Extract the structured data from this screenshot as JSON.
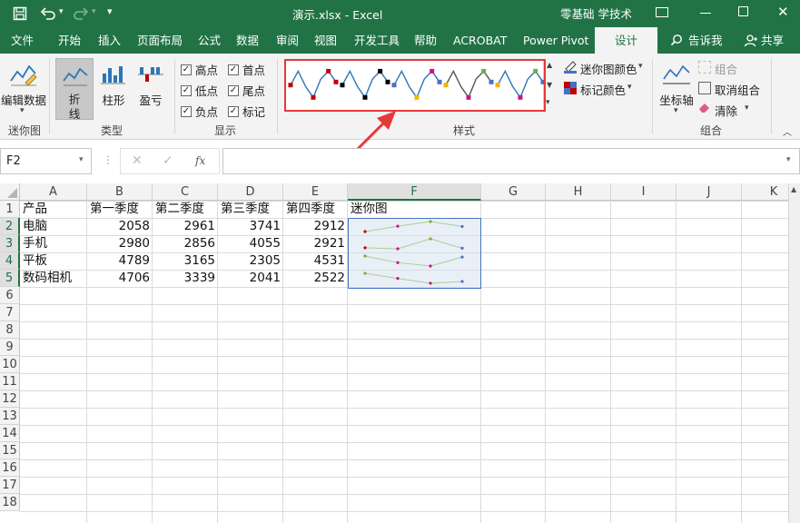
{
  "title_bar": {
    "document_title": "演示.xlsx  -  Excel",
    "account_label": "零基础 学技术",
    "qat_more": "▾"
  },
  "tabs": [
    "文件",
    "开始",
    "插入",
    "页面布局",
    "公式",
    "数据",
    "审阅",
    "视图",
    "开发工具",
    "帮助",
    "ACROBAT",
    "Power Pivot",
    "设计"
  ],
  "tell_me": "告诉我",
  "share": "共享",
  "ribbon": {
    "groups": {
      "sparkline": "迷你图",
      "type": "类型",
      "show": "显示",
      "style": "样式",
      "group": "组合"
    },
    "edit_data": "编辑数据",
    "types": [
      "折\n线",
      "柱形",
      "盈亏"
    ],
    "type_line_1": "折",
    "type_line_2": "线",
    "type_column": "柱形",
    "type_winloss": "盈亏",
    "show_options": [
      {
        "label": "高点",
        "checked": true
      },
      {
        "label": "首点",
        "checked": true
      },
      {
        "label": "低点",
        "checked": true
      },
      {
        "label": "尾点",
        "checked": true
      },
      {
        "label": "负点",
        "checked": true
      },
      {
        "label": "标记",
        "checked": true
      }
    ],
    "sparkline_color": "迷你图颜色",
    "marker_color": "标记颜色",
    "axis": "坐标轴",
    "group_btn": "组合",
    "ungroup": "取消组合",
    "clear": "清除",
    "style_colors": [
      "#c00000",
      "#000000",
      "#4472c4",
      "#70ad47"
    ]
  },
  "formula_bar": {
    "name_box": "F2",
    "fx": "fx",
    "formula": ""
  },
  "columns": [
    "A",
    "B",
    "C",
    "D",
    "E",
    "F",
    "G",
    "H",
    "I",
    "J",
    "K"
  ],
  "rows": [
    "1",
    "2",
    "3",
    "4",
    "5",
    "6",
    "7",
    "8",
    "9",
    "10",
    "11",
    "12",
    "13",
    "14",
    "15",
    "16",
    "17",
    "18"
  ],
  "sheet": {
    "headers": [
      "产品",
      "第一季度",
      "第二季度",
      "第三季度",
      "第四季度",
      "迷你图"
    ],
    "data": [
      {
        "product": "电脑",
        "q1": "2058",
        "q2": "2961",
        "q3": "3741",
        "q4": "2912",
        "values": [
          2058,
          2961,
          3741,
          2912
        ]
      },
      {
        "product": "手机",
        "q1": "2980",
        "q2": "2856",
        "q3": "4055",
        "q4": "2921",
        "values": [
          2980,
          2856,
          4055,
          2921
        ]
      },
      {
        "product": "平板",
        "q1": "4789",
        "q2": "3165",
        "q3": "2305",
        "q4": "4531",
        "values": [
          4789,
          3165,
          2305,
          4531
        ]
      },
      {
        "product": "数码相机",
        "q1": "4706",
        "q2": "3339",
        "q3": "2041",
        "q4": "2522",
        "values": [
          4706,
          3339,
          2041,
          2522
        ]
      }
    ]
  },
  "sparkline_colors": {
    "line": "#a9d18e",
    "high": "#70ad47",
    "low": "#c00000",
    "first": "#c00000",
    "last": "#4472c4",
    "marker": "#c71585",
    "selection": "#4472c4"
  }
}
